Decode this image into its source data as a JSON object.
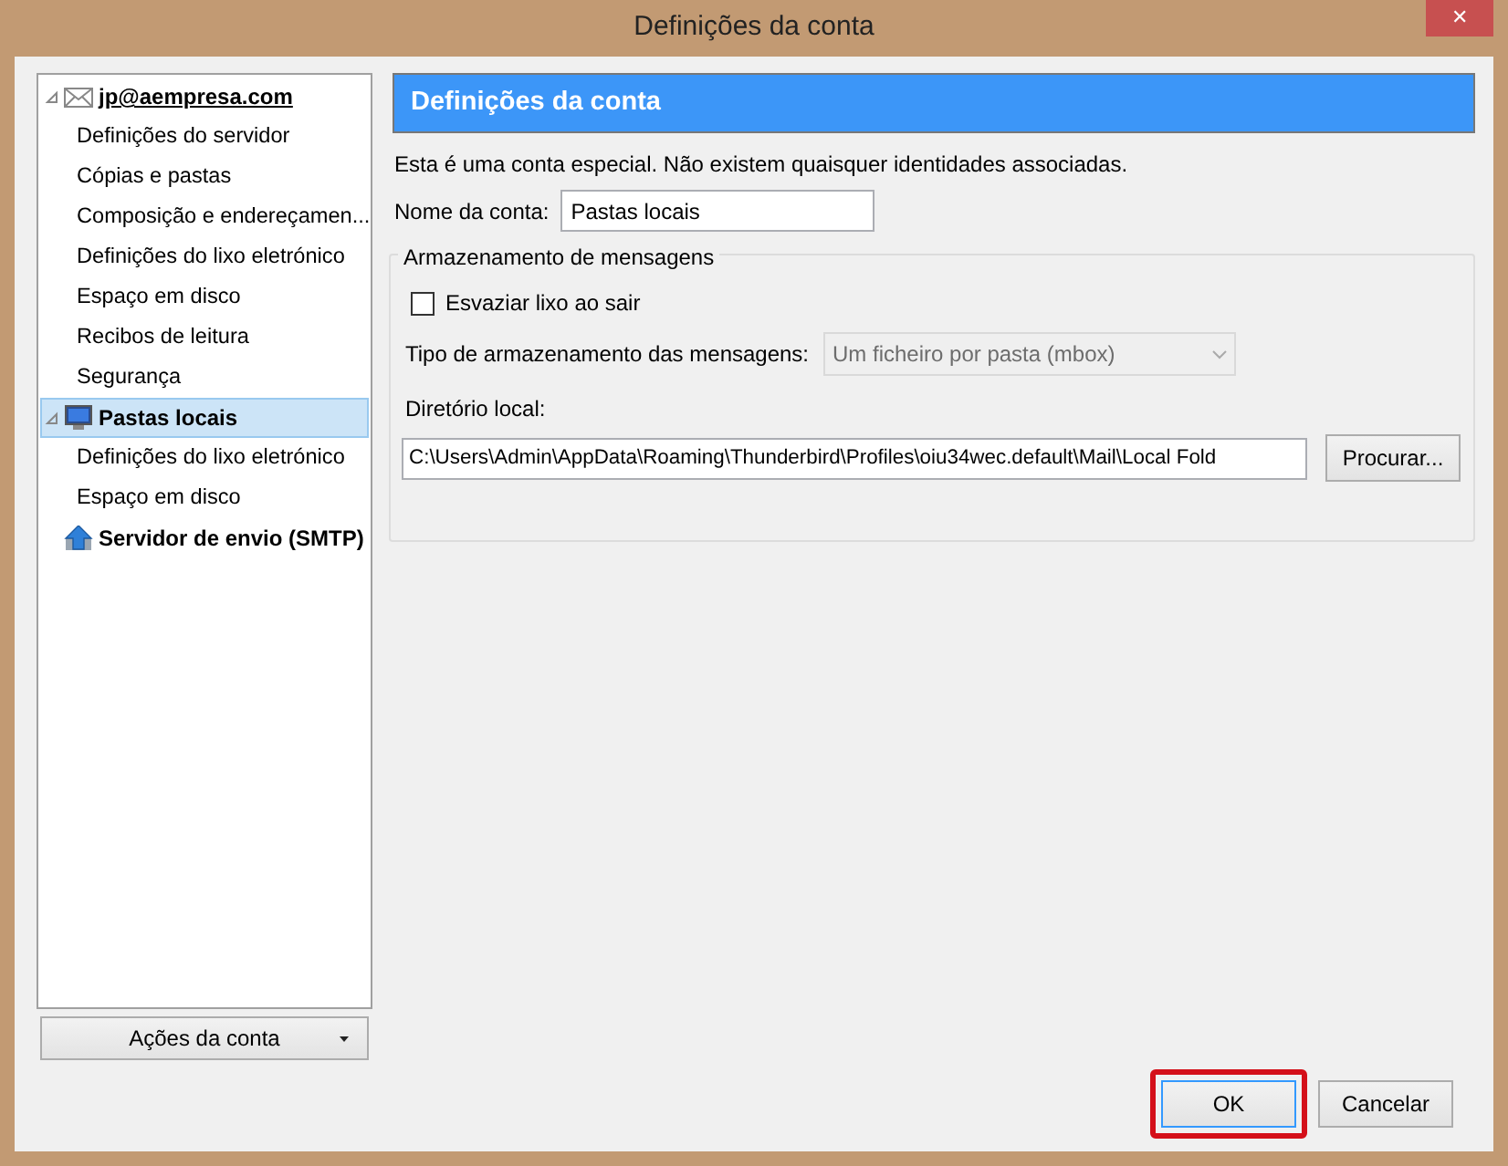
{
  "window": {
    "title": "Definições da conta",
    "close": "✕"
  },
  "tree": [
    {
      "label": "jp@aempresa.com",
      "kind": "mail",
      "expanded": true,
      "selected": false,
      "children": [
        {
          "label": "Definições do servidor",
          "selected": false
        },
        {
          "label": "Cópias e pastas",
          "selected": false
        },
        {
          "label": "Composição e endereçamen...",
          "selected": false
        },
        {
          "label": "Definições do lixo eletrónico",
          "selected": false
        },
        {
          "label": "Espaço em disco",
          "selected": false
        },
        {
          "label": "Recibos de leitura",
          "selected": false
        },
        {
          "label": "Segurança",
          "selected": false
        }
      ]
    },
    {
      "label": "Pastas locais",
      "kind": "computer",
      "expanded": true,
      "selected": true,
      "children": [
        {
          "label": "Definições do lixo eletrónico",
          "selected": false
        },
        {
          "label": "Espaço em disco",
          "selected": false
        }
      ]
    },
    {
      "label": "Servidor de envio (SMTP)",
      "kind": "server",
      "selected": false
    }
  ],
  "account_actions": {
    "label": "Ações da conta"
  },
  "panel": {
    "title": "Definições da conta",
    "info": "Esta é uma conta especial. Não existem quaisquer identidades associadas.",
    "account_name": {
      "label": "Nome da conta:",
      "value": "Pastas locais"
    },
    "storage": {
      "legend": "Armazenamento de mensagens",
      "empty_trash": {
        "label": "Esvaziar lixo ao sair",
        "checked": false
      },
      "store_type": {
        "label": "Tipo de armazenamento das mensagens:",
        "value": "Um ficheiro por pasta (mbox)",
        "disabled": true
      },
      "local_dir": {
        "label": "Diretório local:",
        "value": "C:\\Users\\Admin\\AppData\\Roaming\\Thunderbird\\Profiles\\oiu34wec.default\\Mail\\Local Fold"
      },
      "browse": {
        "label": "Procurar..."
      }
    }
  },
  "buttons": [
    {
      "label": "OK",
      "highlighted": true
    },
    {
      "label": "Cancelar",
      "highlighted": false
    }
  ]
}
